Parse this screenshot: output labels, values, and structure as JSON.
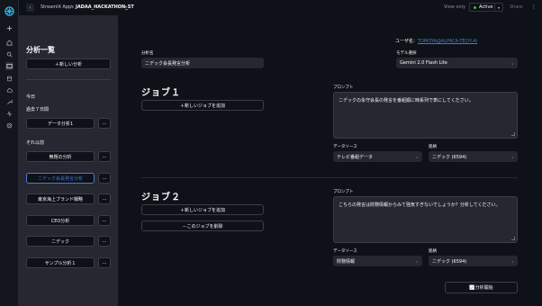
{
  "topbar": {
    "app_name": "Streamlit Apps",
    "separator": "/",
    "repo": "JADAA_HACKATHON_ST",
    "view_only": "View only",
    "status": "Active",
    "share": "Share"
  },
  "sidebar": {
    "title": "分析一覧",
    "new_button": "＋新しい分析",
    "sections": [
      {
        "label": "今日",
        "items": []
      },
      {
        "label": "過去７日間",
        "items": [
          {
            "label": "データ分析1"
          }
        ]
      },
      {
        "label": "それ以前",
        "items": [
          {
            "label": "無題の分析"
          },
          {
            "label": "ニデック会長発言分析",
            "selected": true
          },
          {
            "label": "東京海上ブランド戦略"
          },
          {
            "label": "CEO分析"
          },
          {
            "label": "ニデック"
          },
          {
            "label": "サンプル分析１"
          }
        ]
      }
    ],
    "more_label": "..."
  },
  "main": {
    "user_label": "ユーザ名：",
    "user_name": "TOMOYA@ALPACA-TECH.AI",
    "analysis_name_label": "分析名",
    "analysis_name_value": "ニデック会長発言分析",
    "model_label": "モデル選択",
    "model_value": "Gemini 2.0 Flash Lite",
    "jobs": [
      {
        "title": "ジョブ１",
        "add_button": "＋新しいジョブを追加",
        "prompt_label": "プロンプト",
        "prompt_value": "ニデックの永守会長の発言を番組順に時系列で表にしてください。",
        "datasource_label": "データソース",
        "datasource_value": "テレビ番組データ",
        "ticker_label": "銘柄",
        "ticker_value": "ニデック (6594)"
      },
      {
        "title": "ジョブ２",
        "add_button": "＋新しいジョブを追加",
        "delete_button": "－このジョブを削除",
        "prompt_label": "プロンプト",
        "prompt_value": "こちらの発言は財務情報からみて強気すぎないでしょうか？分析してください。",
        "datasource_label": "データソース",
        "datasource_value": "財務情報",
        "ticker_label": "銘柄",
        "ticker_value": "ニデック (6594)"
      }
    ],
    "run_button": "📈分析開始"
  },
  "colors": {
    "background": "#0e1117",
    "sidebar": "#262730",
    "accent_link": "#4a7bd0",
    "status_dot": "#3fb950"
  }
}
